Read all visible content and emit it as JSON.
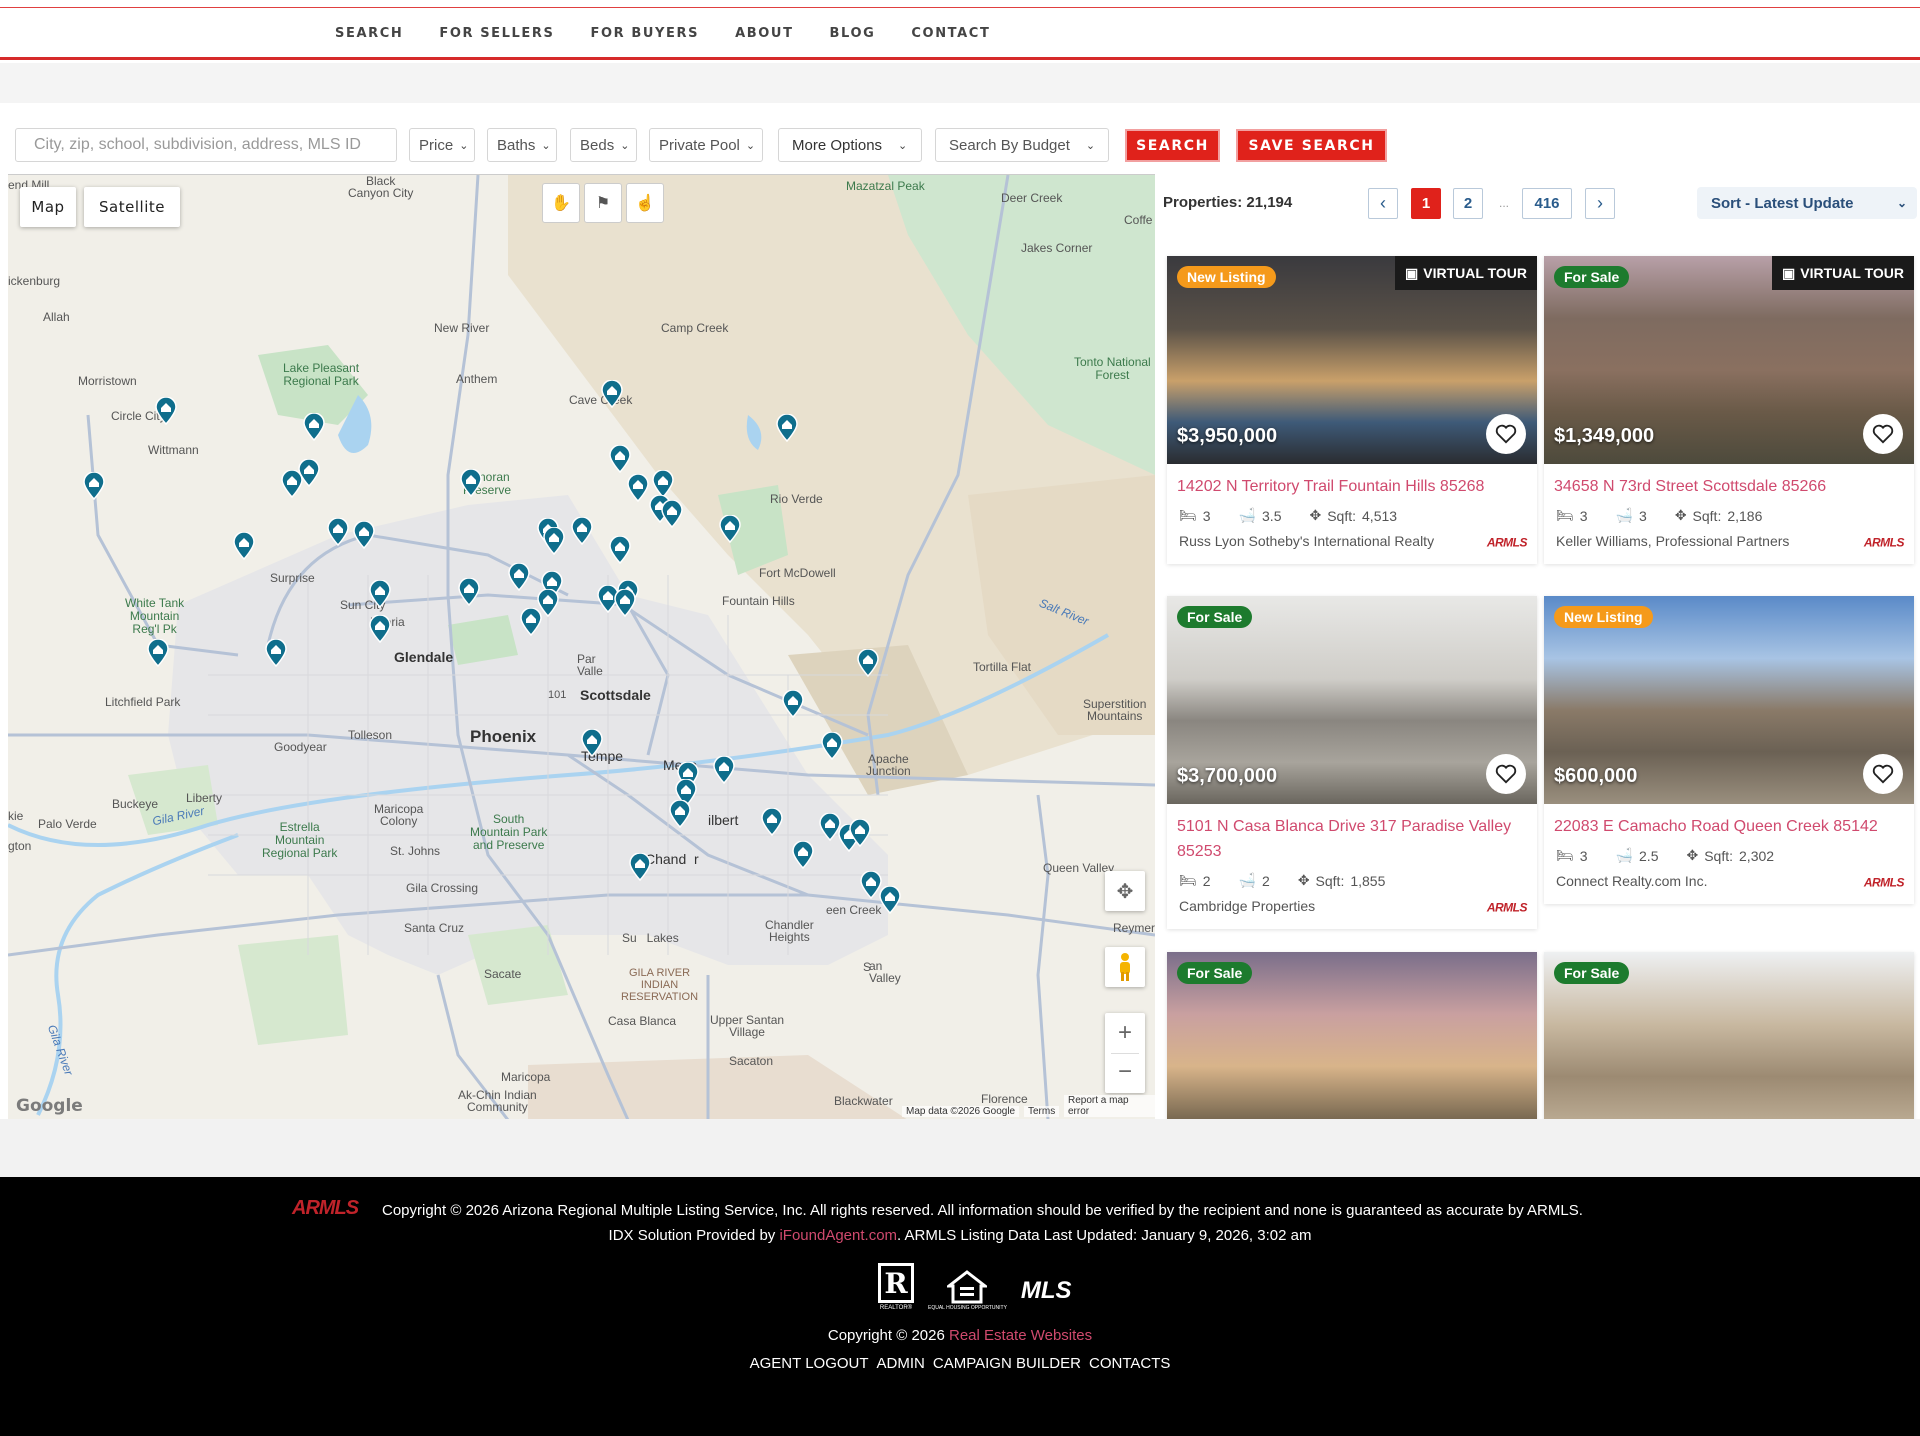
{
  "nav": {
    "items": [
      "SEARCH",
      "FOR SELLERS",
      "FOR BUYERS",
      "ABOUT",
      "BLOG",
      "CONTACT"
    ]
  },
  "filters": {
    "search_placeholder": "City, zip, school, subdivision, address, MLS ID",
    "price": "Price",
    "baths": "Baths",
    "beds": "Beds",
    "pool": "Private Pool",
    "more": "More Options",
    "budget": "Search By Budget",
    "search_btn": "SEARCH",
    "save_btn": "SAVE SEARCH"
  },
  "map": {
    "map_btn": "Map",
    "satellite_btn": "Satellite",
    "attribution": "Map data ©2026 Google",
    "terms": "Terms",
    "report": "Report a map error",
    "google": "Google",
    "labels": {
      "black_canyon": "Black\nCanyon City",
      "mazatzal": "Mazatzal Peak",
      "deer_creek": "Deer Creek",
      "coffee": "Coffe",
      "end_mill": "end Mill",
      "wickenburg": "ickenburg",
      "jakes_corner": "Jakes Corner",
      "allah": "Allah",
      "new_river": "New River",
      "camp_creek": "Camp Creek",
      "lake_pleasant": "Lake Pleasant\nRegional Park",
      "tonto": "Tonto National\nForest",
      "morristown": "Morristown",
      "anthem": "Anthem",
      "cave_creek": "Cave Creek",
      "circle_city": "Circle City",
      "wittmann": "Wittmann",
      "sonoran": "Sonoran\nPreserve",
      "rio_verde": "Rio Verde",
      "surprise": "Surprise",
      "fort_mcdowell": "Fort McDowell",
      "fountain_hills": "Fountain Hills",
      "white_tank": "White Tank\nMountain\nReg'l Pk",
      "sun_city": "Sun City",
      "peoria": "Peoria",
      "salt_river": "Salt River",
      "glendale": "Glendale",
      "paradise_valley": "Par\nValle",
      "tortilla_flat": "Tortilla Flat",
      "scottsdale": "Scottsdale",
      "litchfield": "Litchfield Park",
      "superstition": "Superstition\nMountains",
      "phoenix": "Phoenix",
      "goodyear": "Goodyear",
      "tolleson": "Tolleson",
      "tempe": "Tempe",
      "mesa": "Mesa",
      "apache_junction": "Apache\nJunction",
      "buckeye": "Buckeye",
      "liberty": "Liberty",
      "maricopa_colony": "Maricopa\nColony",
      "south_mountain": "South\nMountain Park\nand Preserve",
      "gilbert": "ilbert",
      "kie": "kie",
      "palo_verde": "Palo Verde",
      "gila_river": "Gila River",
      "estrella": "Estrella\nMountain\nRegional Park",
      "st_johns": "St. Johns",
      "chandler": "Chand",
      "chandler_r": "r",
      "queen_valley": "Queen Valley",
      "gton": "gton",
      "gila_crossing": "Gila Crossing",
      "queen_creek": "een Creek",
      "reymer": "Reymer",
      "santa_cruz": "Santa Cruz",
      "sun_lakes": "Su   Lakes",
      "chandler_heights": "Chandler\nHeights",
      "san_tan": "an\nValley",
      "san_tan_s": "S",
      "sacate": "Sacate",
      "gila_indian": "GILA RIVER\nINDIAN\nRESERVATION",
      "casa_blanca": "Casa Blanca",
      "upper_santan": "Upper Santan\nVillage",
      "gila_river_v": "Gila River",
      "sacaton": "Sacaton",
      "maricopa": "Maricopa",
      "florence": "Florence",
      "blackwater": "Blackwater",
      "ak_chin": "Ak-Chin Indian\nCommunity"
    }
  },
  "listings": {
    "count_label": "Properties: 21,194",
    "pages": [
      "1",
      "2",
      "416"
    ],
    "dots": "...",
    "sort": "Sort - Latest Update",
    "cards": [
      {
        "badge": "New Listing",
        "badge_type": "new",
        "virtual_tour": "VIRTUAL TOUR",
        "price": "$3,950,000",
        "address": "14202 N Territory Trail Fountain Hills 85268",
        "beds": "3",
        "baths": "3.5",
        "sqft_label": "Sqft:",
        "sqft": "4,513",
        "agent": "Russ Lyon Sotheby's International Realty",
        "mls_logo": "ARMLS"
      },
      {
        "badge": "For Sale",
        "badge_type": "sale",
        "virtual_tour": "VIRTUAL TOUR",
        "price": "$1,349,000",
        "address": "34658 N 73rd Street Scottsdale 85266",
        "beds": "3",
        "baths": "3",
        "sqft_label": "Sqft:",
        "sqft": "2,186",
        "agent": "Keller Williams, Professional Partners",
        "mls_logo": "ARMLS"
      },
      {
        "badge": "For Sale",
        "badge_type": "sale",
        "price": "$3,700,000",
        "address": "5101 N Casa Blanca Drive 317 Paradise Valley 85253",
        "beds": "2",
        "baths": "2",
        "sqft_label": "Sqft:",
        "sqft": "1,855",
        "agent": "Cambridge Properties",
        "mls_logo": "ARMLS"
      },
      {
        "badge": "New Listing",
        "badge_type": "new",
        "price": "$600,000",
        "address": "22083 E Camacho Road Queen Creek 85142",
        "beds": "3",
        "baths": "2.5",
        "sqft_label": "Sqft:",
        "sqft": "2,302",
        "agent": "Connect Realty.com Inc.",
        "mls_logo": "ARMLS"
      },
      {
        "badge": "For Sale",
        "badge_type": "sale"
      },
      {
        "badge": "For Sale",
        "badge_type": "sale"
      }
    ]
  },
  "footer": {
    "armls_logo": "ARMLS",
    "copyright_main": "Copyright © 2026 Arizona Regional Multiple Listing Service, Inc. All rights reserved. All information should be verified by the recipient and none is guaranteed as accurate by ARMLS.",
    "idx_prefix": "IDX Solution Provided by ",
    "idx_link": "iFoundAgent.com",
    "idx_suffix": ". ARMLS Listing Data Last Updated: January 9, 2026, 3:02 am",
    "realtor_label": "REALTOR®",
    "eho_label": "EQUAL HOUSING OPPORTUNITY",
    "mls_label": "MLS",
    "copyright2_prefix": "Copyright © 2026 ",
    "copyright2_link": "Real Estate Websites",
    "links": [
      "AGENT LOGOUT",
      "ADMIN",
      "CAMPAIGN BUILDER",
      "CONTACTS"
    ]
  },
  "colors": {
    "brand_red": "#e0221b",
    "pin_blue": "#0f6e8c",
    "link_pink": "#d04a6e",
    "badge_orange": "#f59a1b",
    "badge_green": "#1d7b2e"
  }
}
